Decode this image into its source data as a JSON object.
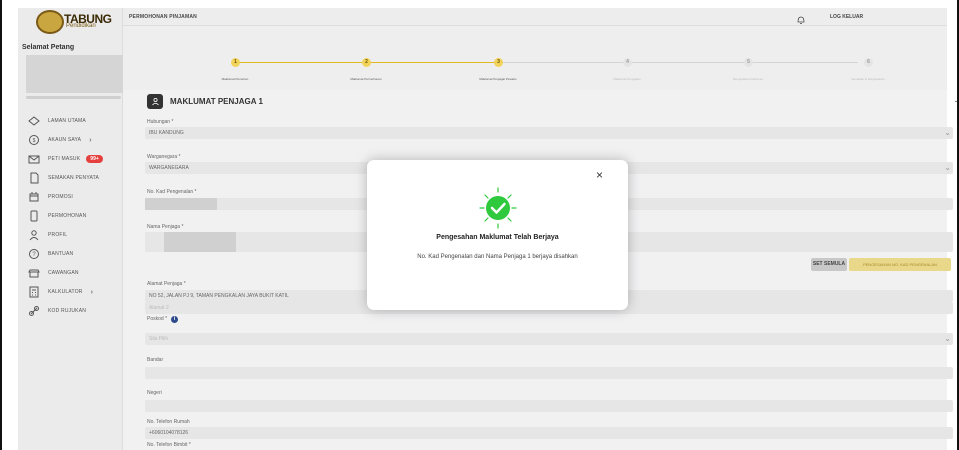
{
  "app": {
    "logo_text": "TABUNG",
    "logo_sub": "Pendidikan",
    "greeting": "Selamat Petang"
  },
  "sidebar": {
    "items": [
      {
        "label": "LAMAN UTAMA",
        "icon": "home-icon"
      },
      {
        "label": "AKAUN SAYA",
        "icon": "account-icon",
        "has_chevron": true
      },
      {
        "label": "PETI MASUK",
        "icon": "mail-icon",
        "badge": "99+"
      },
      {
        "label": "SEMAKAN PENYATA",
        "icon": "document-icon"
      },
      {
        "label": "PROMOSI",
        "icon": "promo-icon"
      },
      {
        "label": "PERMOHONAN",
        "icon": "application-icon"
      },
      {
        "label": "PROFIL",
        "icon": "profile-icon"
      },
      {
        "label": "BANTUAN",
        "icon": "help-icon"
      },
      {
        "label": "CAWANGAN",
        "icon": "branch-icon"
      },
      {
        "label": "KALKULATOR",
        "icon": "calculator-icon",
        "has_chevron": true
      },
      {
        "label": "KOD RUJUKAN",
        "icon": "link-icon"
      }
    ]
  },
  "topbar": {
    "title": "PERMOHONAN PINJAMAN",
    "logout": "LOG KELUAR"
  },
  "stepper": {
    "steps": [
      {
        "num": "1",
        "label": "Maklumat Pemohon",
        "active": true
      },
      {
        "num": "2",
        "label": "Maklumat Permohonan",
        "active": true
      },
      {
        "num": "3",
        "label": "Maklumat Penjaga/ Pewaris",
        "active": true
      },
      {
        "num": "4",
        "label": "Maklumat Pengajian",
        "active": false
      },
      {
        "num": "5",
        "label": "Pengesahan Dokumen",
        "active": false
      },
      {
        "num": "6",
        "label": "Semakan & Pengesahan",
        "active": false
      }
    ]
  },
  "section": {
    "title": "MAKLUMAT PENJAGA 1"
  },
  "form": {
    "hubungan_label": "Hubungan *",
    "hubungan_value": "IBU KANDUNG",
    "warganegara_label": "Warganegara *",
    "warganegara_value": "WARGANEGARA",
    "kad_label": "No. Kad Pengenalan *",
    "nama_label": "Nama Penjaga *",
    "reset_button": "SET SEMULA",
    "verify_button": "PENGESAHAN NO. KAD PENGENALAN",
    "alamat_label": "Alamat Penjaga *",
    "alamat_value": "NO 52, JALAN PJ 9, TAMAN PENGKALAN JAYA BUKIT KATIL",
    "alamat2_placeholder": "Alamat 2",
    "poskod_label": "Poskod *",
    "poskod_placeholder": "Sila Pilih",
    "bandar_label": "Bandar",
    "negeri_label": "Negeri",
    "tel_rumah_label": "No. Telefon Rumah",
    "tel_rumah_value": "+6060104078126",
    "tel_bimbit_label": "No. Telefon Bimbit *"
  },
  "modal": {
    "title": "Pengesahan Maklumat Telah Berjaya",
    "message": "No. Kad Pengenalan dan Nama Penjaga 1 berjaya disahkan",
    "accent": "#2ec93c"
  },
  "colors": {
    "accent": "#e0b81f",
    "inactive": "#bbbbbb"
  }
}
